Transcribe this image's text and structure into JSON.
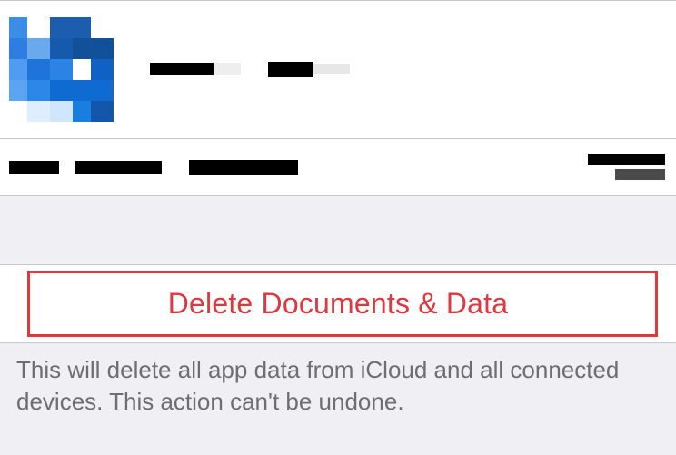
{
  "colors": {
    "destructive": "#e0383e",
    "secondary_text": "#6d6d72",
    "grouped_bg": "#efeff4"
  },
  "app_info": {
    "name_redacted": true,
    "subtitle_redacted": true
  },
  "row": {
    "label_redacted": true,
    "value_redacted": true
  },
  "actions": {
    "delete_label": "Delete Documents & Data"
  },
  "footer": {
    "warning": "This will delete all app data from iCloud and all connected devices. This action can't be undone."
  }
}
